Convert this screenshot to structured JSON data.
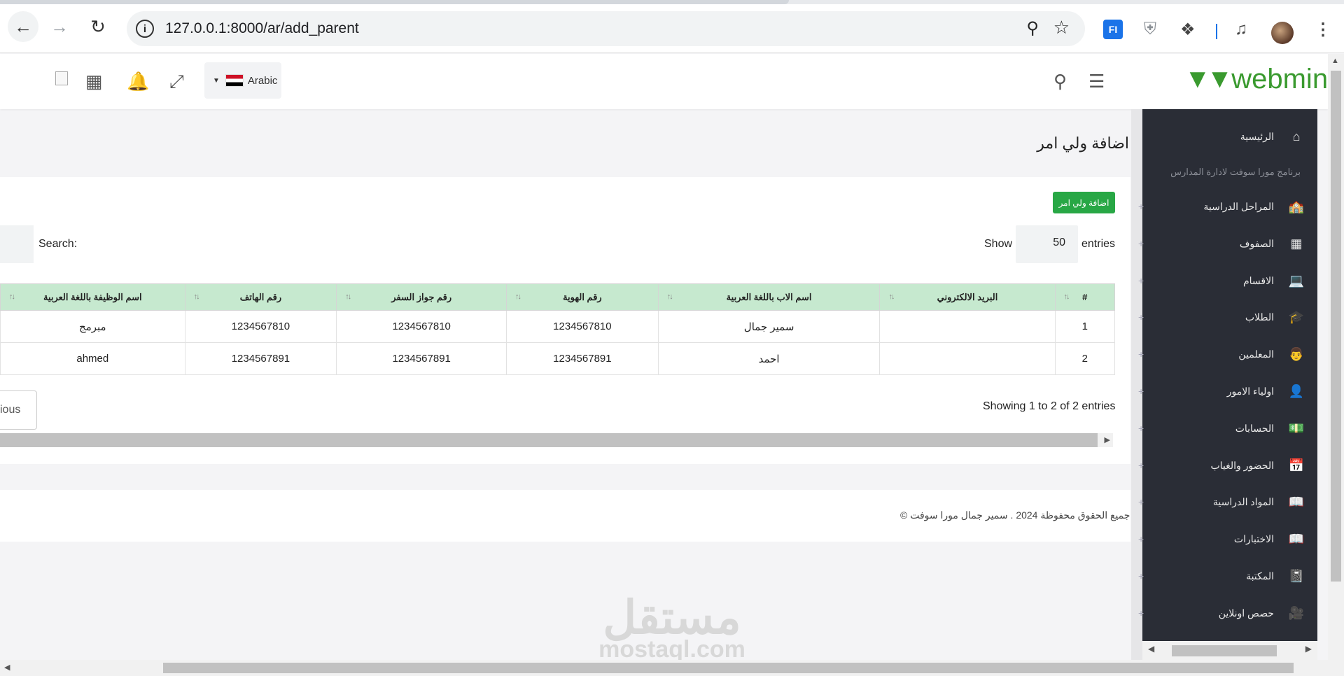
{
  "browser": {
    "url": "127.0.0.1:8000/ar/add_parent",
    "ext_fi_label": "FI"
  },
  "header": {
    "language": "Arabic",
    "logo_text": "webmin"
  },
  "sidebar": {
    "tagline": "برنامج مورا سوفت لادارة المدارس",
    "items": [
      {
        "label": "الرئيسية",
        "icon": "home-icon"
      },
      {
        "label": "المراحل الدراسية",
        "icon": "school-icon"
      },
      {
        "label": "الصفوف",
        "icon": "building-icon"
      },
      {
        "label": "الاقسام",
        "icon": "monitor-icon"
      },
      {
        "label": "الطلاب",
        "icon": "graduate-icon"
      },
      {
        "label": "المعلمين",
        "icon": "teacher-icon"
      },
      {
        "label": "اولياء الامور",
        "icon": "user-icon"
      },
      {
        "label": "الحسابات",
        "icon": "money-icon"
      },
      {
        "label": "الحضور والغياب",
        "icon": "calendar-icon"
      },
      {
        "label": "المواد الدراسية",
        "icon": "book-icon"
      },
      {
        "label": "الاختبارات",
        "icon": "book-open-icon"
      },
      {
        "label": "المكتبة",
        "icon": "library-icon"
      },
      {
        "label": "حصص اونلاين",
        "icon": "video-icon"
      }
    ]
  },
  "page": {
    "title": "اضافة ولي امر",
    "add_button": "اضافة ولي امر",
    "show_label": "Show",
    "show_value": "50",
    "entries_label": "entries",
    "search_label": "Search:",
    "showing_text": "Showing 1 to 2 of 2 entries",
    "prev_button": "ious"
  },
  "table": {
    "headers": [
      "#",
      "البريد الالكتروني",
      "اسم الاب باللغة العربية",
      "رقم الهوية",
      "رقم جواز السفر",
      "رقم الهاتف",
      "اسم الوظيفة باللغة العربية"
    ],
    "rows": [
      [
        "1",
        "",
        "سمير جمال",
        "1234567810",
        "1234567810",
        "1234567810",
        "مبرمج"
      ],
      [
        "2",
        "",
        "احمد",
        "1234567891",
        "1234567891",
        "1234567891",
        "ahmed"
      ]
    ]
  },
  "footer": {
    "text": "© جميع الحقوق محفوظة 2024 . سمير جمال مورا سوفت"
  },
  "watermark": {
    "arabic": "مستقل",
    "latin": "mostaql.com"
  },
  "colors": {
    "accent_green": "#28a745",
    "sidebar_bg": "#2a2d36",
    "table_header": "#c6e9cf",
    "logo_green": "#3a9a2f"
  }
}
